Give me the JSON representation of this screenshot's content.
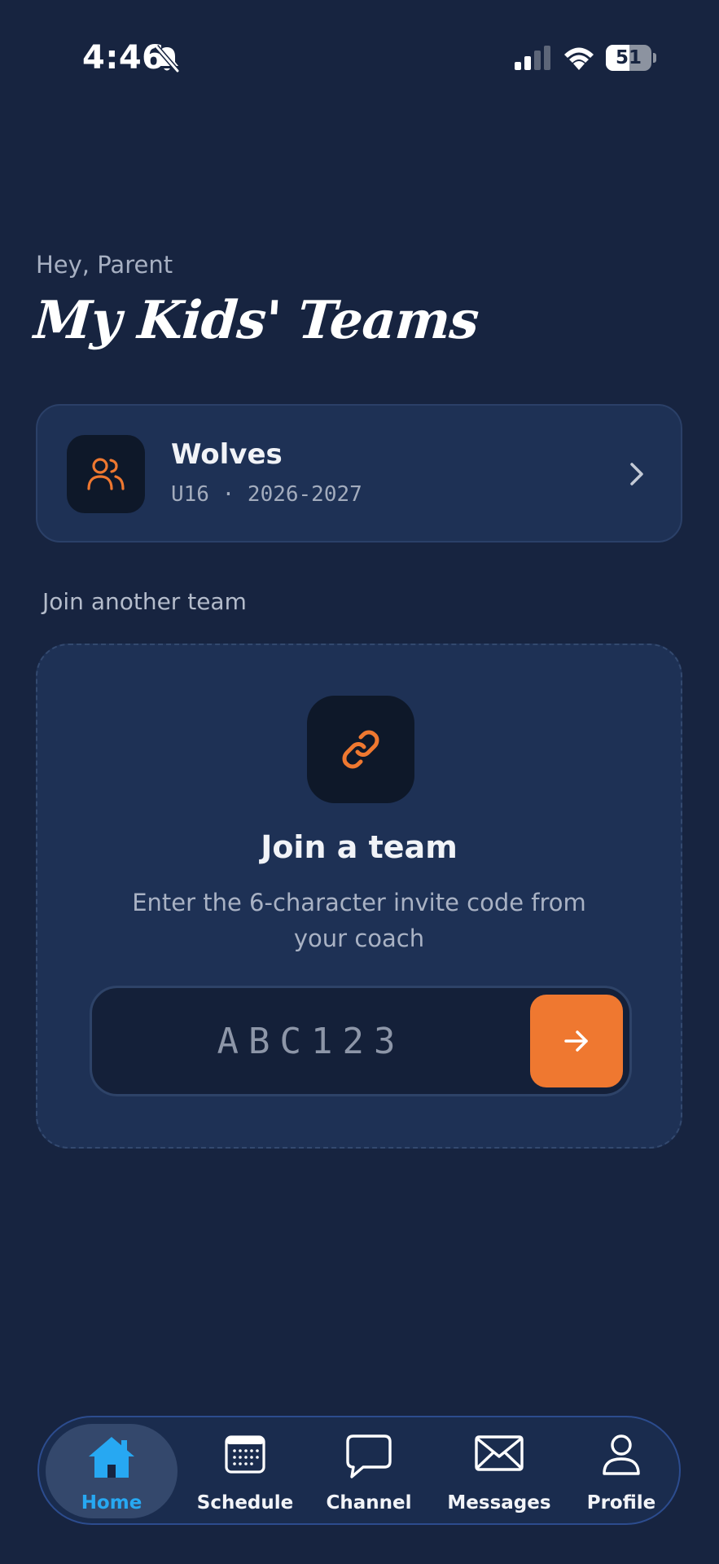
{
  "status_bar": {
    "time": "4:46",
    "battery_level": "51",
    "battery_fraction": 0.51
  },
  "header": {
    "greeting": "Hey, Parent",
    "title": "My Kids' Teams"
  },
  "team_card": {
    "name": "Wolves",
    "meta": "U16 · 2026-2027",
    "icon": "users-icon"
  },
  "join_section": {
    "label": "Join another team",
    "icon": "link-icon",
    "title": "Join a team",
    "description": "Enter the 6-character invite code from your coach",
    "code_placeholder": "ABC123",
    "code_value": "",
    "submit_icon": "arrow-right-icon"
  },
  "tab_bar": {
    "tabs": [
      {
        "label": "Home",
        "icon": "home-icon",
        "active": true
      },
      {
        "label": "Schedule",
        "icon": "calendar-icon",
        "active": false
      },
      {
        "label": "Channel",
        "icon": "chat-bubble-icon",
        "active": false
      },
      {
        "label": "Messages",
        "icon": "envelope-icon",
        "active": false
      },
      {
        "label": "Profile",
        "icon": "user-icon",
        "active": false
      }
    ]
  },
  "colors": {
    "background": "#172440",
    "card": "#1e3155",
    "accent": "#ef7830",
    "tab_active": "#27a8f2"
  }
}
